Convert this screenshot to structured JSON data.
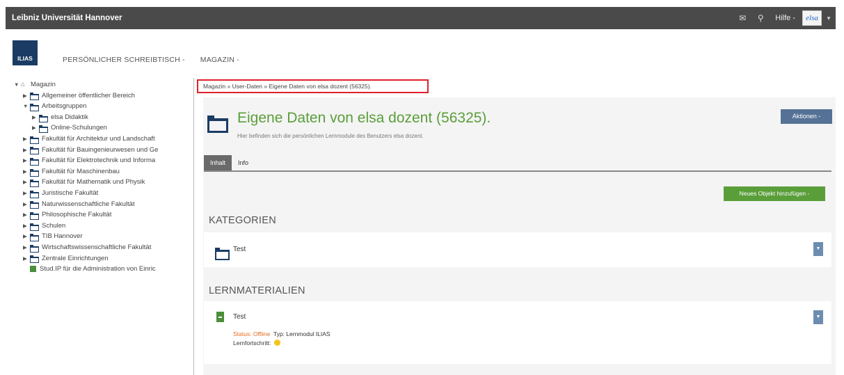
{
  "topbar": {
    "brand": "Leibniz Universität Hannover",
    "mail_icon": "envelope-icon",
    "search_icon": "search-icon",
    "help_label": "Hilfe",
    "help_caret": "-",
    "avatar_text": "elsa",
    "user_caret": "▾"
  },
  "header": {
    "logo_text": "ILIAS",
    "nav": [
      "PERSÖNLICHER SCHREIBTISCH -",
      "MAGAZIN -"
    ]
  },
  "tree": {
    "items": [
      {
        "label": "Magazin",
        "arrow": "▼",
        "icon": "home-icon",
        "level": 0
      },
      {
        "label": "Allgemeiner öffentlicher Bereich",
        "arrow": "▶",
        "icon": "folder-icon",
        "level": 1
      },
      {
        "label": "Arbeitsgruppen",
        "arrow": "▼",
        "icon": "folder-icon",
        "level": 1
      },
      {
        "label": "elsa Didaktik",
        "arrow": "▶",
        "icon": "folder-icon",
        "level": 2
      },
      {
        "label": "Online-Schulungen",
        "arrow": "▶",
        "icon": "folder-icon",
        "level": 2
      },
      {
        "label": "Fakultät für Architektur und Landschaft",
        "arrow": "▶",
        "icon": "folder-icon",
        "level": 1
      },
      {
        "label": "Fakultät für Bauingenieurwesen und Ge",
        "arrow": "▶",
        "icon": "folder-icon",
        "level": 1
      },
      {
        "label": "Fakultät für Elektrotechnik und Informa",
        "arrow": "▶",
        "icon": "folder-icon",
        "level": 1
      },
      {
        "label": "Fakultät für Maschinenbau",
        "arrow": "▶",
        "icon": "folder-icon",
        "level": 1
      },
      {
        "label": "Fakultät für Mathematik und Physik",
        "arrow": "▶",
        "icon": "folder-icon",
        "level": 1
      },
      {
        "label": "Juristische Fakultät",
        "arrow": "▶",
        "icon": "folder-icon",
        "level": 1
      },
      {
        "label": "Naturwissenschaftliche Fakultät",
        "arrow": "▶",
        "icon": "folder-icon",
        "level": 1
      },
      {
        "label": "Philosophische Fakultät",
        "arrow": "▶",
        "icon": "folder-icon",
        "level": 1
      },
      {
        "label": "Schulen",
        "arrow": "▶",
        "icon": "folder-icon",
        "level": 1
      },
      {
        "label": "TIB Hannover",
        "arrow": "▶",
        "icon": "folder-icon",
        "level": 1
      },
      {
        "label": "Wirtschaftswissenschaftliche Fakultät",
        "arrow": "▶",
        "icon": "folder-icon",
        "level": 1
      },
      {
        "label": "Zentrale Einrichtungen",
        "arrow": "▶",
        "icon": "folder-icon",
        "level": 1
      },
      {
        "label": "Stud.IP für die Administration von Einric",
        "arrow": "",
        "icon": "learning-module-icon",
        "level": 1
      }
    ]
  },
  "breadcrumb": "Magazin » User-Daten » Eigene Daten von elsa dozent (56325).",
  "page": {
    "title": "Eigene Daten von elsa dozent (56325).",
    "description": "Hier befinden sich die persönlichen Lernmodule des Benutzers elsa dozent.",
    "actions_label": "Aktionen -",
    "tabs": [
      "Inhalt",
      "Info"
    ],
    "active_tab": "Inhalt",
    "add_button": "Neues Objekt hinzufügen -"
  },
  "sections": {
    "categories": {
      "heading": "KATEGORIEN",
      "items": [
        {
          "title": "Test",
          "icon": "folder-icon"
        }
      ]
    },
    "learning_materials": {
      "heading": "LERNMATERIALIEN",
      "items": [
        {
          "title": "Test",
          "icon": "learning-module-icon",
          "status_label": "Status:",
          "status_value": "Offline",
          "type_label": "Typ:",
          "type_value": "Lernmodul ILIAS",
          "progress_label": "Lernfortschritt:",
          "progress_icon": "progress-in-progress-icon"
        }
      ]
    }
  },
  "colors": {
    "topbar": "#4a4a4a",
    "title_green": "#5a9e3a",
    "actions_blue": "#557196",
    "offline_orange": "#e46b1f",
    "progress_yellow": "#f1c51a",
    "highlight_red": "#e0202a"
  }
}
